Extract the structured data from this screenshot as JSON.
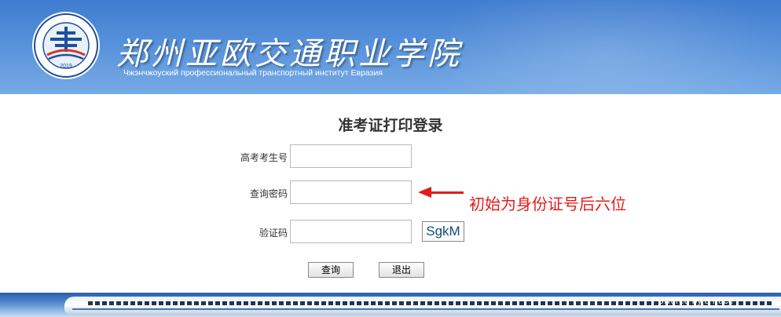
{
  "header": {
    "logo": {
      "icon": "school-emblem",
      "year": "2019"
    },
    "school_name": "郑州亚欧交通职业学院",
    "school_subtitle": "Чжэнчжоуский профессиональный транспортный институт Евразия"
  },
  "page_title": "准考证打印登录",
  "form": {
    "exam_no_label": "高考考生号",
    "exam_no_value": "",
    "password_label": "查询密码",
    "password_value": "",
    "captcha_label": "验证码",
    "captcha_value": "",
    "captcha_text": "SgkM"
  },
  "annotation": {
    "text": "初始为身份证号后六位",
    "color": "#e31b1b"
  },
  "buttons": {
    "query": "查询",
    "exit": "退出"
  },
  "footer": {
    "watermark": "Powered by a Fuce"
  },
  "colors": {
    "header_blue": "#4a86d6",
    "accent_red": "#e31b1b"
  }
}
